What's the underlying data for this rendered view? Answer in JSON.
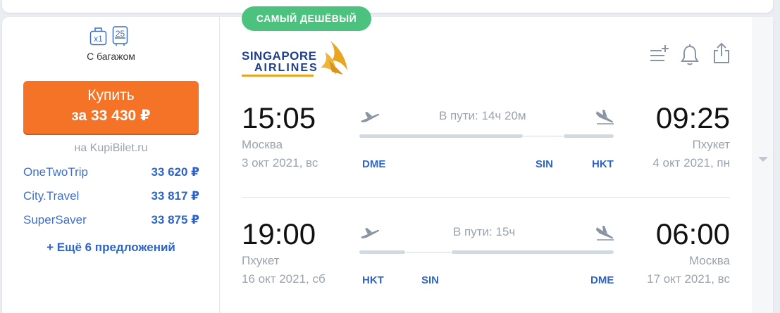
{
  "baggage": {
    "handbag_count": "x1",
    "suitcase_weight": "25",
    "label": "С багажом"
  },
  "buy": {
    "line1": "Купить",
    "line2": "за 33 430 ₽",
    "agency": "на KupiBilet.ru"
  },
  "offers": [
    {
      "name": "OneTwoTrip",
      "price": "33 620 ₽"
    },
    {
      "name": "City.Travel",
      "price": "33 817 ₽"
    },
    {
      "name": "SuperSaver",
      "price": "33 875 ₽"
    }
  ],
  "more_offers": "+ Ещё 6 предложений",
  "badge": "САМЫЙ ДЕШЁВЫЙ",
  "airline": {
    "logo_line1": "SINGAPORE",
    "logo_line2": "AIRLINES"
  },
  "colors": {
    "accent_orange": "#f57326",
    "badge_green": "#4bc37f",
    "link_blue": "#2e64c7",
    "muted": "#9aa3ad"
  },
  "icons": [
    "add-to-list-icon",
    "bell-icon",
    "share-icon",
    "plane-takeoff-icon",
    "plane-landing-icon"
  ],
  "segments": [
    {
      "depart_time": "15:05",
      "depart_city": "Москва",
      "depart_date": "3 окт 2021, вс",
      "duration": "В пути: 14ч 20м",
      "arrive_time": "09:25",
      "arrive_city": "Пхукет",
      "arrive_date": "4 окт 2021, пн",
      "airports": [
        "DME",
        "SIN",
        "HKT"
      ]
    },
    {
      "depart_time": "19:00",
      "depart_city": "Пхукет",
      "depart_date": "16 окт 2021, сб",
      "duration": "В пути: 15ч",
      "arrive_time": "06:00",
      "arrive_city": "Москва",
      "arrive_date": "17 окт 2021, вс",
      "airports": [
        "HKT",
        "SIN",
        "DME"
      ]
    }
  ]
}
